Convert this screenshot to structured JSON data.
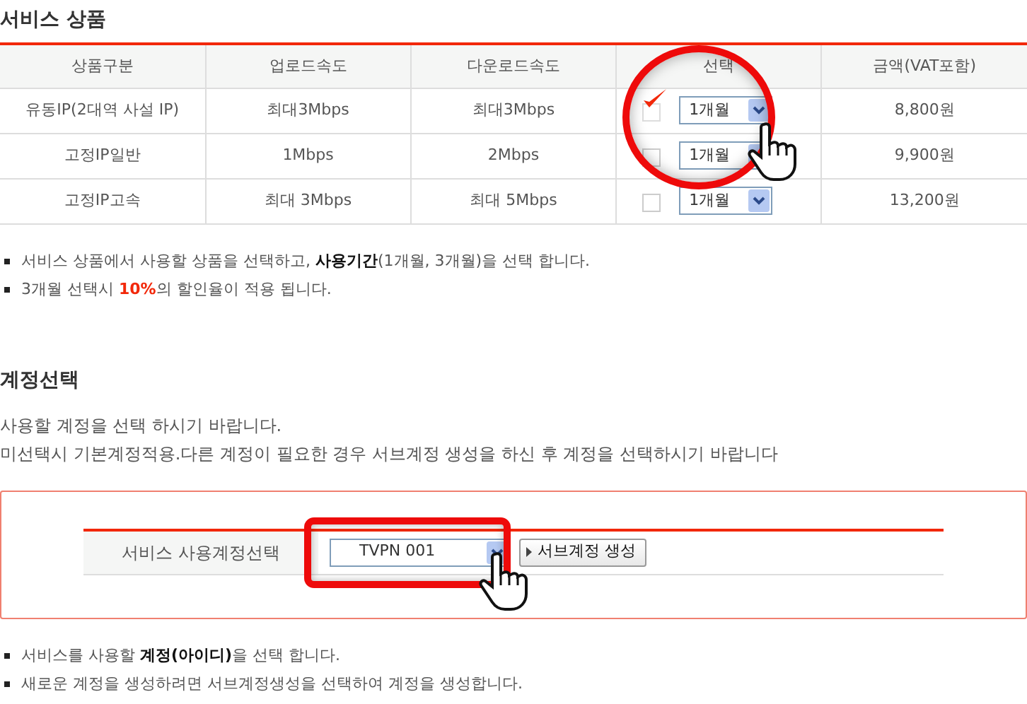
{
  "products": {
    "title": "서비스 상품",
    "columns": [
      "상품구분",
      "업로드속도",
      "다운로드속도",
      "선택",
      "금액(VAT포함)"
    ],
    "rows": [
      {
        "type": "유동IP(2대역 사설 IP)",
        "upload": "최대3Mbps",
        "download": "최대3Mbps",
        "checked": true,
        "period": "1개월",
        "price": "8,800원"
      },
      {
        "type": "고정IP일반",
        "upload": "1Mbps",
        "download": "2Mbps",
        "checked": false,
        "period": "1개월",
        "price": "9,900원"
      },
      {
        "type": "고정IP고속",
        "upload": "최대 3Mbps",
        "download": "최대 5Mbps",
        "checked": false,
        "period": "1개월",
        "price": "13,200원"
      }
    ],
    "notes": [
      "서비스 상품에서 사용할 상품을 선택하고, **사용기간**(1개월, 3개월)을 선택 합니다.",
      "3개월 선택시 **10%**의 할인율이 적용 됩니다."
    ]
  },
  "account": {
    "title": "계정선택",
    "description": [
      "사용할 계정을 선택 하시기 바랍니다.",
      "미선택시 기본계정적용.다른 계정이 필요한 경우 서브계정 생성을 하신 후 계정을 선택하시기 바랍니다"
    ],
    "label": "서비스 사용계정선택",
    "selected_account": "TVPN 001",
    "create_button": "서브계정 생성",
    "notes": [
      "서비스를 사용할 **계정(아이디)**을 선택 합니다.",
      "새로운 계정을 생성하려면 서브계정생성을 선택하여 계정을 생성합니다."
    ]
  }
}
